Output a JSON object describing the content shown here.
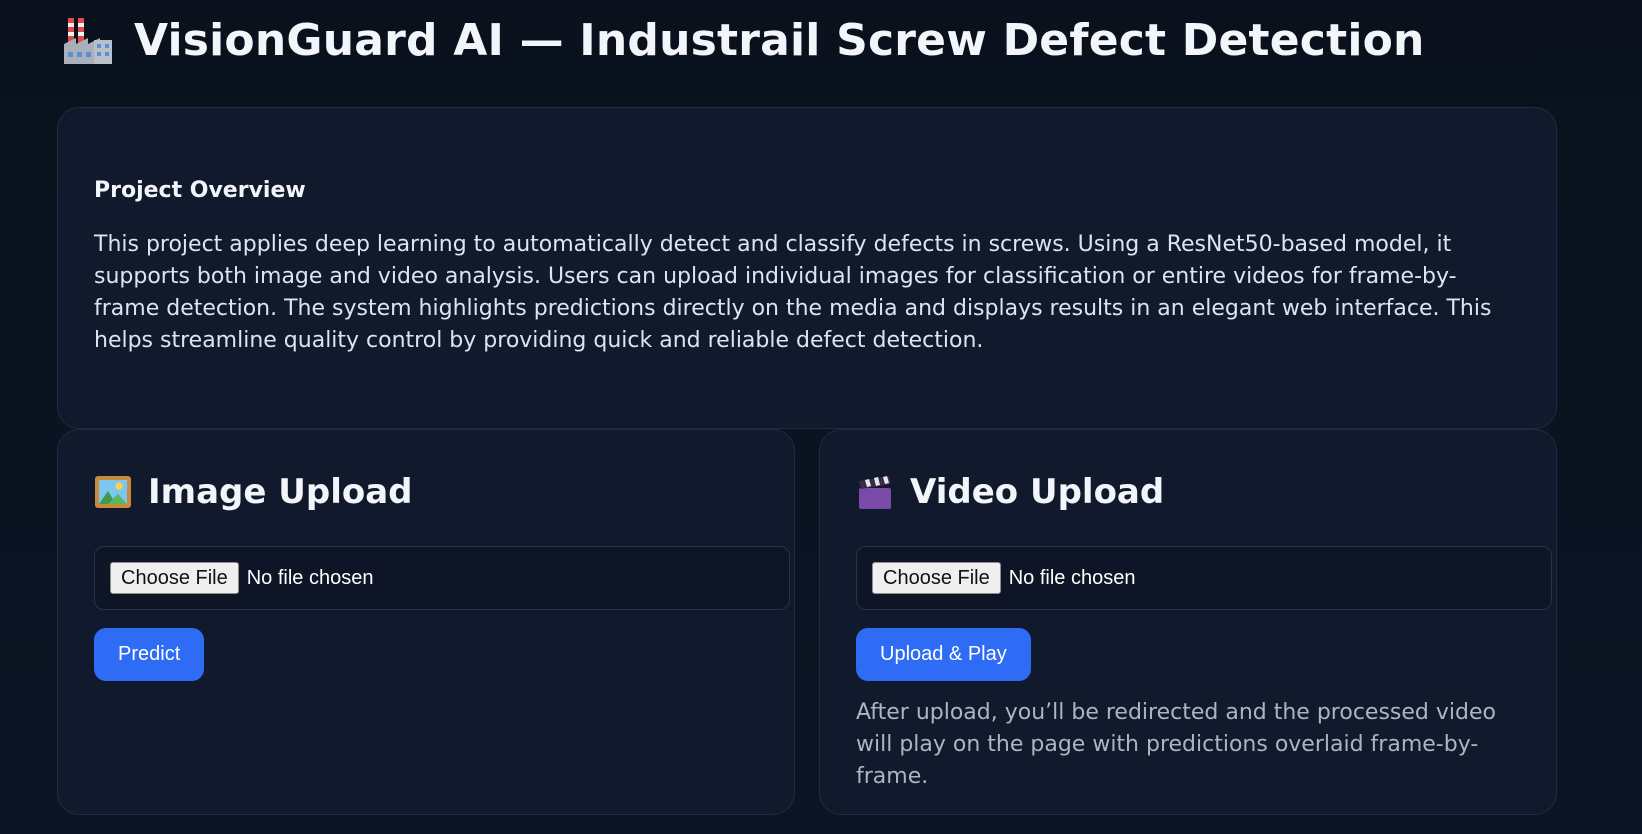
{
  "header": {
    "title": "VisionGuard AI — Industrail Screw Defect Detection",
    "icon": "factory-icon"
  },
  "overview": {
    "heading": "Project Overview",
    "text": "This project applies deep learning to automatically detect and classify defects in screws. Using a ResNet50-based model, it supports both image and video analysis. Users can upload individual images for classification or entire videos for frame-by-frame detection. The system highlights predictions directly on the media and displays results in an elegant web interface. This helps streamline quality control by providing quick and reliable defect detection."
  },
  "image_upload": {
    "icon": "framed-picture-icon",
    "title": "Image Upload",
    "choose_label": "Choose File",
    "file_status": "No file chosen",
    "button_label": "Predict"
  },
  "video_upload": {
    "icon": "clapper-board-icon",
    "title": "Video Upload",
    "choose_label": "Choose File",
    "file_status": "No file chosen",
    "button_label": "Upload & Play",
    "note": "After upload, you’ll be redirected and the processed video will play on the page with predictions overlaid frame-by-frame."
  },
  "colors": {
    "background": "#0b1220",
    "card": "#111a2c",
    "accent": "#2f6cf5",
    "muted_text": "#a9b4c5"
  }
}
